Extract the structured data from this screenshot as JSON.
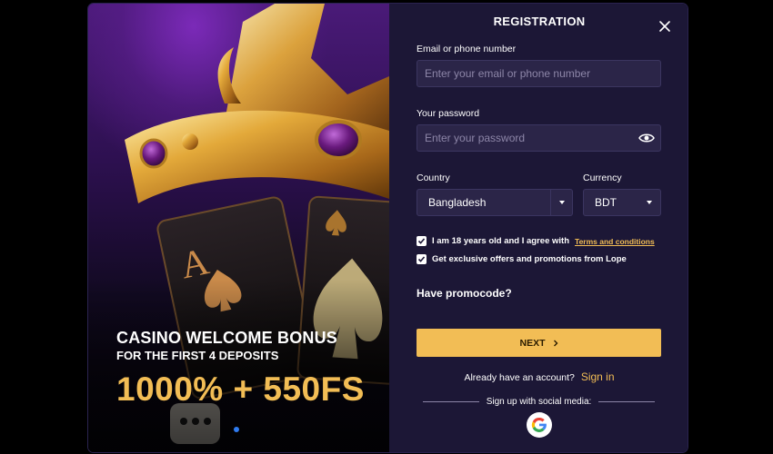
{
  "promo": {
    "title": "CASINO WELCOME BONUS",
    "subtitle": "FOR THE FIRST 4 DEPOSITS",
    "amount": "1000% + 550FS"
  },
  "form": {
    "title": "REGISTRATION",
    "email_label": "Email or phone number",
    "email_placeholder": "Enter your email or phone number",
    "password_label": "Your password",
    "password_placeholder": "Enter your password",
    "country_label": "Country",
    "country_value": "Bangladesh",
    "currency_label": "Currency",
    "currency_value": "BDT",
    "age_text": "I am 18 years old and I agree with",
    "terms_link": "Terms and conditions",
    "offers_text": "Get exclusive offers and promotions from Lope",
    "age_checked": true,
    "offers_checked": true,
    "promocode_label": "Have promocode?",
    "next_label": "NEXT",
    "account_text": "Already have an account?",
    "signin_label": "Sign in",
    "social_label": "Sign up with social media:"
  },
  "icons": {
    "close": "close-icon",
    "eye": "eye-icon",
    "google": "google-icon",
    "caret": "chevron-down-icon"
  },
  "colors": {
    "accent": "#f2bd55",
    "panel_bg": "#1c1736",
    "field_bg": "#2b2548",
    "link_blue": "#2f7bf0"
  }
}
